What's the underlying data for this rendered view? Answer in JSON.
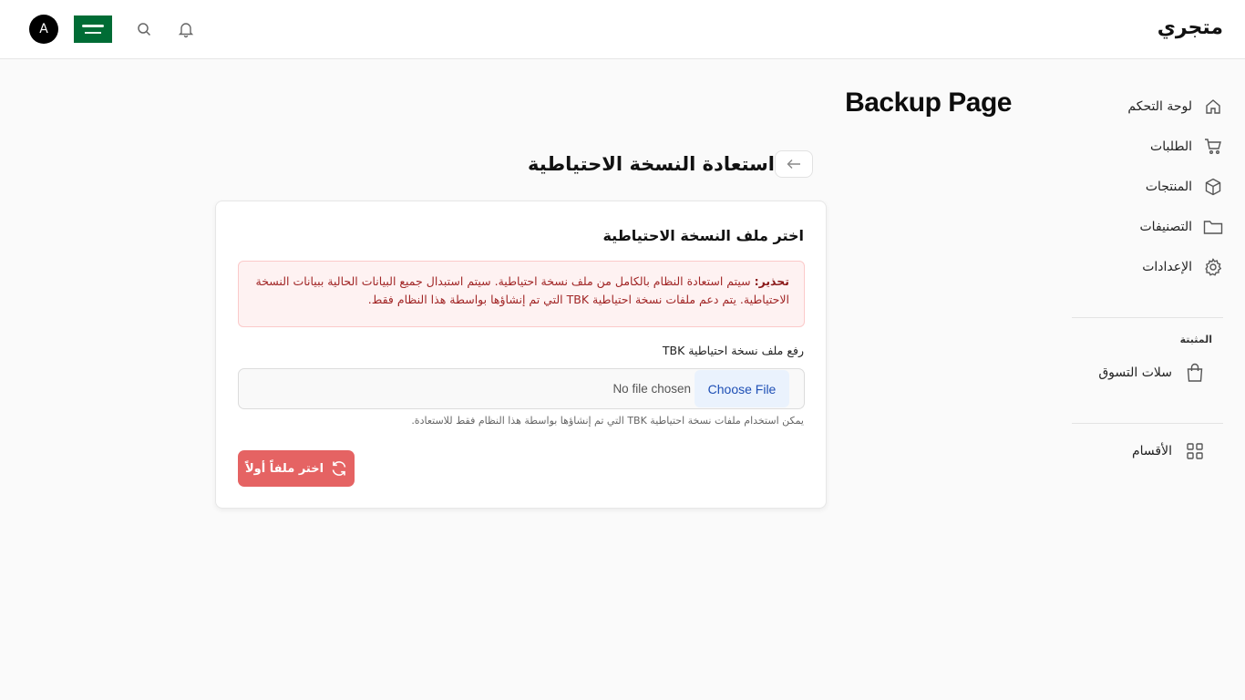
{
  "header": {
    "brand": "متجري",
    "avatar_initial": "A",
    "flag_icon": "saudi-flag-icon",
    "icons": [
      "search-icon",
      "bell-icon"
    ]
  },
  "sidebar": {
    "items": [
      {
        "label": "لوحة التحكم",
        "icon": "home-icon"
      },
      {
        "label": "الطلبات",
        "icon": "cart-icon"
      },
      {
        "label": "المنتجات",
        "icon": "box-icon"
      },
      {
        "label": "التصنيفات",
        "icon": "folder-icon"
      },
      {
        "label": "الإعدادات",
        "icon": "gear-icon"
      }
    ],
    "pinned_title": "المثبتة",
    "pinned_items": [
      {
        "label": "سلات التسوق",
        "icon": "shopping-bag-icon"
      }
    ],
    "extra_items": [
      {
        "label": "الأقسام",
        "icon": "grid-icon"
      }
    ]
  },
  "main": {
    "page_title": "Backup Page",
    "sub_title": "استعادة النسخة الاحتياطية",
    "card": {
      "title": "اختر ملف النسخة الاحتياطية",
      "alert_strong": "تحذير:",
      "alert_text": " سيتم استعادة النظام بالكامل من ملف نسخة احتياطية. سيتم استبدال جميع البيانات الحالية ببيانات النسخة الاحتياطية. يتم دعم ملفات نسخة احتياطية TBK التي تم إنشاؤها بواسطة هذا النظام فقط.",
      "upload_label": "رفع ملف نسخة احتياطية TBK",
      "choose_file": "Choose File",
      "no_file": "No file chosen",
      "hint": "يمكن استخدام ملفات نسخة احتياطية TBK التي تم إنشاؤها بواسطة هذا النظام فقط للاستعادة.",
      "submit_label": "اختر ملفاً أولاً"
    }
  },
  "colors": {
    "accent_red": "#e56363",
    "alert_bg": "#fef2f2",
    "file_button_bg": "#eaf2fd"
  }
}
